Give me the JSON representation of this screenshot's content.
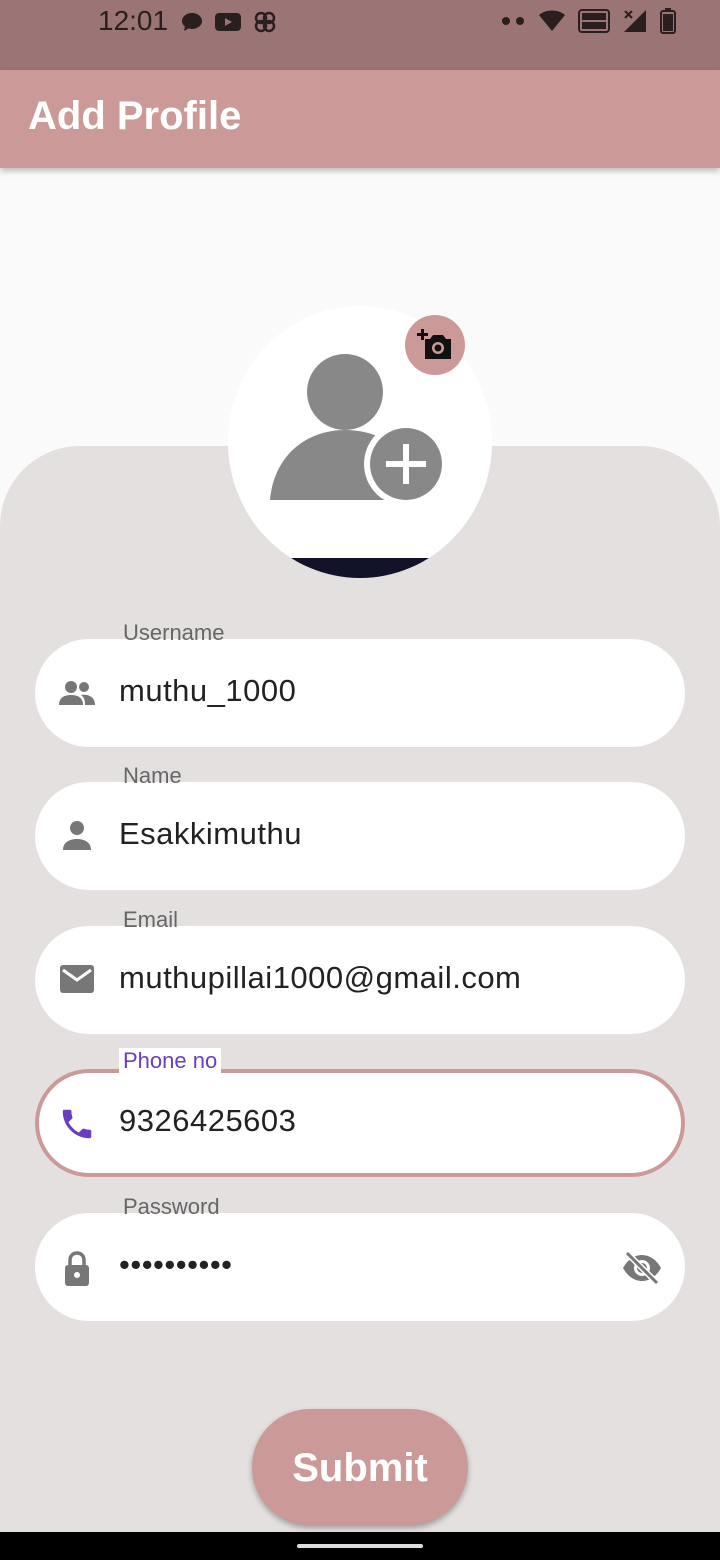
{
  "status_bar": {
    "time": "12:01",
    "left_icons": [
      "chat-icon",
      "youtube-icon",
      "pinwheel-icon"
    ],
    "right_icons": [
      "dots-icon",
      "wifi-icon",
      "vowifi-icon",
      "signal-icon",
      "battery-icon"
    ]
  },
  "app_bar": {
    "title": "Add Profile"
  },
  "avatar": {
    "icon": "add-person-icon",
    "camera_icon": "add-photo-icon"
  },
  "fields": [
    {
      "label": "Username",
      "value": "muthu_1000",
      "icon": "people-icon"
    },
    {
      "label": "Name",
      "value": "Esakkimuthu",
      "icon": "person-icon"
    },
    {
      "label": "Email",
      "value": "muthupillai1000@gmail.com",
      "icon": "mail-icon"
    },
    {
      "label": "Phone no",
      "value": "9326425603",
      "icon": "phone-icon",
      "focused": true
    },
    {
      "label": "Password",
      "value": "••••••••••",
      "icon": "lock-icon",
      "trailing_icon": "visibility-off-icon"
    }
  ],
  "submit": {
    "label": "Submit"
  },
  "colors": {
    "accent": "#cc9999",
    "status_bar": "#9b7575",
    "panel": "#e4e0e0",
    "focus_label": "#6a3fbf"
  }
}
